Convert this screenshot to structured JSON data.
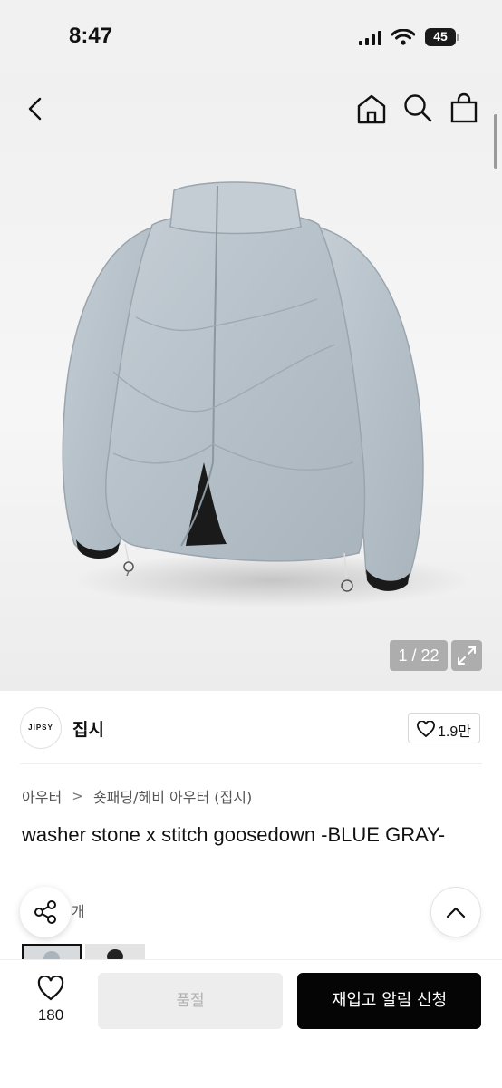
{
  "status_bar": {
    "time": "8:47",
    "battery": "45"
  },
  "nav": {
    "back_icon": "chevron-left-icon",
    "home_icon": "home-icon",
    "search_icon": "search-icon",
    "bag_icon": "shopping-bag-icon"
  },
  "gallery": {
    "counter": "1 / 22",
    "expand_icon": "expand-icon"
  },
  "brand": {
    "logo_text": "JIPSY",
    "name": "집시",
    "like_count": "1.9만"
  },
  "breadcrumb": {
    "level1": "아우터",
    "separator": ">",
    "level2": "숏패딩/헤비 아우터 (집시)"
  },
  "product": {
    "title": "washer stone x stitch goosedown -BLUE GRAY-",
    "reviews": "후기 42개"
  },
  "bottom_bar": {
    "wish_count": "180",
    "soldout_label": "품절",
    "restock_label": "재입고 알림 신청"
  },
  "colors": {
    "accent": "#050505",
    "disabled": "#ededed",
    "jacket": "#b9c3cb"
  }
}
